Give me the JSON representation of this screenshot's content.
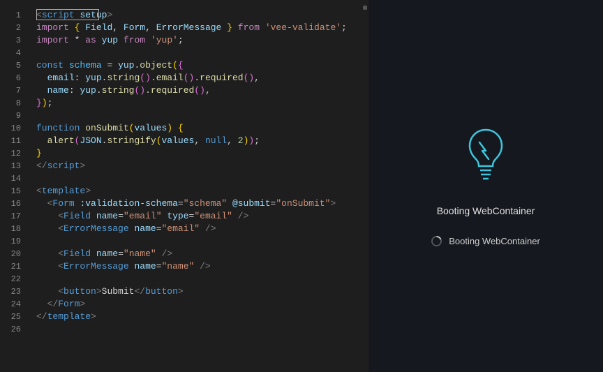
{
  "editor": {
    "lines": [
      {
        "n": 1,
        "html": "<span class='tok-tag'>&lt;</span><span class='tok-tagname'>script</span> <span class='tok-attr'>setup</span><span class='tok-tag'>&gt;</span>"
      },
      {
        "n": 2,
        "html": "<span class='tok-import'>import</span> <span class='tok-brace'>{</span> <span class='tok-var'>Field</span><span class='tok-punct'>,</span> <span class='tok-var'>Form</span><span class='tok-punct'>,</span> <span class='tok-var'>ErrorMessage</span> <span class='tok-brace'>}</span> <span class='tok-import'>from</span> <span class='tok-string'>'vee-validate'</span><span class='tok-punct'>;</span>"
      },
      {
        "n": 3,
        "html": "<span class='tok-import'>import</span> <span class='tok-op'>*</span> <span class='tok-import'>as</span> <span class='tok-var'>yup</span> <span class='tok-import'>from</span> <span class='tok-string'>'yup'</span><span class='tok-punct'>;</span>"
      },
      {
        "n": 4,
        "html": ""
      },
      {
        "n": 5,
        "html": "<span class='tok-keyword'>const</span> <span class='tok-const'>schema</span> <span class='tok-op'>=</span> <span class='tok-var'>yup</span><span class='tok-punct'>.</span><span class='tok-func'>object</span><span class='tok-brace'>(</span><span class='tok-brace2'>{</span>"
      },
      {
        "n": 6,
        "html": "  <span class='tok-prop'>email</span><span class='tok-punct'>:</span> <span class='tok-var'>yup</span><span class='tok-punct'>.</span><span class='tok-func'>string</span><span class='tok-brace2'>()</span><span class='tok-punct'>.</span><span class='tok-func'>email</span><span class='tok-brace2'>()</span><span class='tok-punct'>.</span><span class='tok-func'>required</span><span class='tok-brace2'>()</span><span class='tok-punct'>,</span>"
      },
      {
        "n": 7,
        "html": "  <span class='tok-prop'>name</span><span class='tok-punct'>:</span> <span class='tok-var'>yup</span><span class='tok-punct'>.</span><span class='tok-func'>string</span><span class='tok-brace2'>()</span><span class='tok-punct'>.</span><span class='tok-func'>required</span><span class='tok-brace2'>()</span><span class='tok-punct'>,</span>"
      },
      {
        "n": 8,
        "html": "<span class='tok-brace2'>}</span><span class='tok-brace'>)</span><span class='tok-punct'>;</span>"
      },
      {
        "n": 9,
        "html": ""
      },
      {
        "n": 10,
        "html": "<span class='tok-keyword'>function</span> <span class='tok-func'>onSubmit</span><span class='tok-brace'>(</span><span class='tok-var'>values</span><span class='tok-brace'>)</span> <span class='tok-brace'>{</span>"
      },
      {
        "n": 11,
        "html": "  <span class='tok-func'>alert</span><span class='tok-brace2'>(</span><span class='tok-var'>JSON</span><span class='tok-punct'>.</span><span class='tok-func'>stringify</span><span class='tok-brace'>(</span><span class='tok-var'>values</span><span class='tok-punct'>,</span> <span class='tok-keyword'>null</span><span class='tok-punct'>,</span> <span class='tok-number'>2</span><span class='tok-brace'>)</span><span class='tok-brace2'>)</span><span class='tok-punct'>;</span>"
      },
      {
        "n": 12,
        "html": "<span class='tok-brace'>}</span>"
      },
      {
        "n": 13,
        "html": "<span class='tok-tag'>&lt;/</span><span class='tok-tagname'>script</span><span class='tok-tag'>&gt;</span>"
      },
      {
        "n": 14,
        "html": ""
      },
      {
        "n": 15,
        "html": "<span class='tok-tag'>&lt;</span><span class='tok-tagname'>template</span><span class='tok-tag'>&gt;</span>"
      },
      {
        "n": 16,
        "html": "  <span class='tok-tag'>&lt;</span><span class='tok-tagname'>Form</span> <span class='tok-attr'>:validation-schema</span><span class='tok-punct'>=</span><span class='tok-string'>\"schema\"</span> <span class='tok-attr'>@submit</span><span class='tok-punct'>=</span><span class='tok-string'>\"onSubmit\"</span><span class='tok-tag'>&gt;</span>"
      },
      {
        "n": 17,
        "html": "    <span class='tok-tag'>&lt;</span><span class='tok-tagname'>Field</span> <span class='tok-attr'>name</span><span class='tok-punct'>=</span><span class='tok-string'>\"email\"</span> <span class='tok-attr'>type</span><span class='tok-punct'>=</span><span class='tok-string'>\"email\"</span> <span class='tok-tag'>/&gt;</span>"
      },
      {
        "n": 18,
        "html": "    <span class='tok-tag'>&lt;</span><span class='tok-tagname'>ErrorMessage</span> <span class='tok-attr'>name</span><span class='tok-punct'>=</span><span class='tok-string'>\"email\"</span> <span class='tok-tag'>/&gt;</span>"
      },
      {
        "n": 19,
        "html": ""
      },
      {
        "n": 20,
        "html": "    <span class='tok-tag'>&lt;</span><span class='tok-tagname'>Field</span> <span class='tok-attr'>name</span><span class='tok-punct'>=</span><span class='tok-string'>\"name\"</span> <span class='tok-tag'>/&gt;</span>"
      },
      {
        "n": 21,
        "html": "    <span class='tok-tag'>&lt;</span><span class='tok-tagname'>ErrorMessage</span> <span class='tok-attr'>name</span><span class='tok-punct'>=</span><span class='tok-string'>\"name\"</span> <span class='tok-tag'>/&gt;</span>"
      },
      {
        "n": 22,
        "html": ""
      },
      {
        "n": 23,
        "html": "    <span class='tok-tag'>&lt;</span><span class='tok-tagname'>button</span><span class='tok-tag'>&gt;</span><span class='tok-text'>Submit</span><span class='tok-tag'>&lt;/</span><span class='tok-tagname'>button</span><span class='tok-tag'>&gt;</span>"
      },
      {
        "n": 24,
        "html": "  <span class='tok-tag'>&lt;/</span><span class='tok-tagname'>Form</span><span class='tok-tag'>&gt;</span>"
      },
      {
        "n": 25,
        "html": "<span class='tok-tag'>&lt;/</span><span class='tok-tagname'>template</span><span class='tok-tag'>&gt;</span>"
      },
      {
        "n": 26,
        "html": ""
      }
    ]
  },
  "preview": {
    "title": "Booting WebContainer",
    "status": "Booting WebContainer"
  }
}
